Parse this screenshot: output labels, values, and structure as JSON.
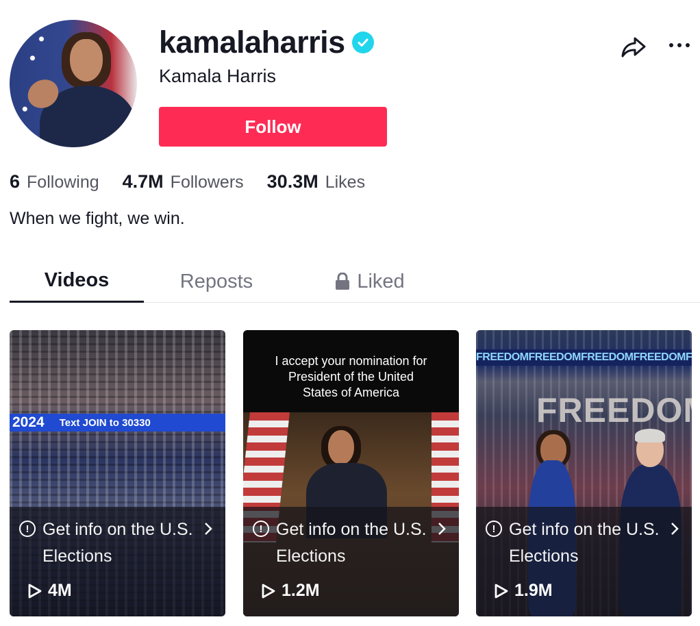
{
  "profile": {
    "username": "kamalaharris",
    "display_name": "Kamala Harris",
    "follow_label": "Follow",
    "bio": "When we fight, we win."
  },
  "stats": [
    {
      "value": "6",
      "label": "Following"
    },
    {
      "value": "4.7M",
      "label": "Followers"
    },
    {
      "value": "30.3M",
      "label": "Likes"
    }
  ],
  "tabs": [
    {
      "label": "Videos",
      "active": true
    },
    {
      "label": "Reposts",
      "active": false
    },
    {
      "label": "Liked",
      "active": false,
      "icon": "lock-icon"
    }
  ],
  "videos": [
    {
      "overlay_banner_year": "2024",
      "overlay_banner_text": "Text JOIN to 30330",
      "info_text": "Get info on the U.S. Elections",
      "info_icon": "info-icon",
      "plays": "4M"
    },
    {
      "caption": "I accept your nomination for President of the United States of America",
      "info_text": "Get info on the U.S. Elections",
      "info_icon": "info-icon",
      "plays": "1.2M"
    },
    {
      "strip_text": "FREEDOMFREEDOMFREEDOMFREEDOMFREEDOMFREEDOM",
      "stage_text": "FREEDOM",
      "info_text": "Get info on the U.S. Elections",
      "info_icon": "info-icon",
      "plays": "1.9M"
    }
  ],
  "colors": {
    "accent": "#fe2c55",
    "verified": "#20d5ec",
    "text_primary": "#161823",
    "text_secondary": "#545560"
  },
  "icons": {
    "verified": "verified-check-icon",
    "share": "share-arrow-icon",
    "more": "more-horizontal-icon",
    "play": "play-icon",
    "chevron": "chevron-right-icon"
  }
}
